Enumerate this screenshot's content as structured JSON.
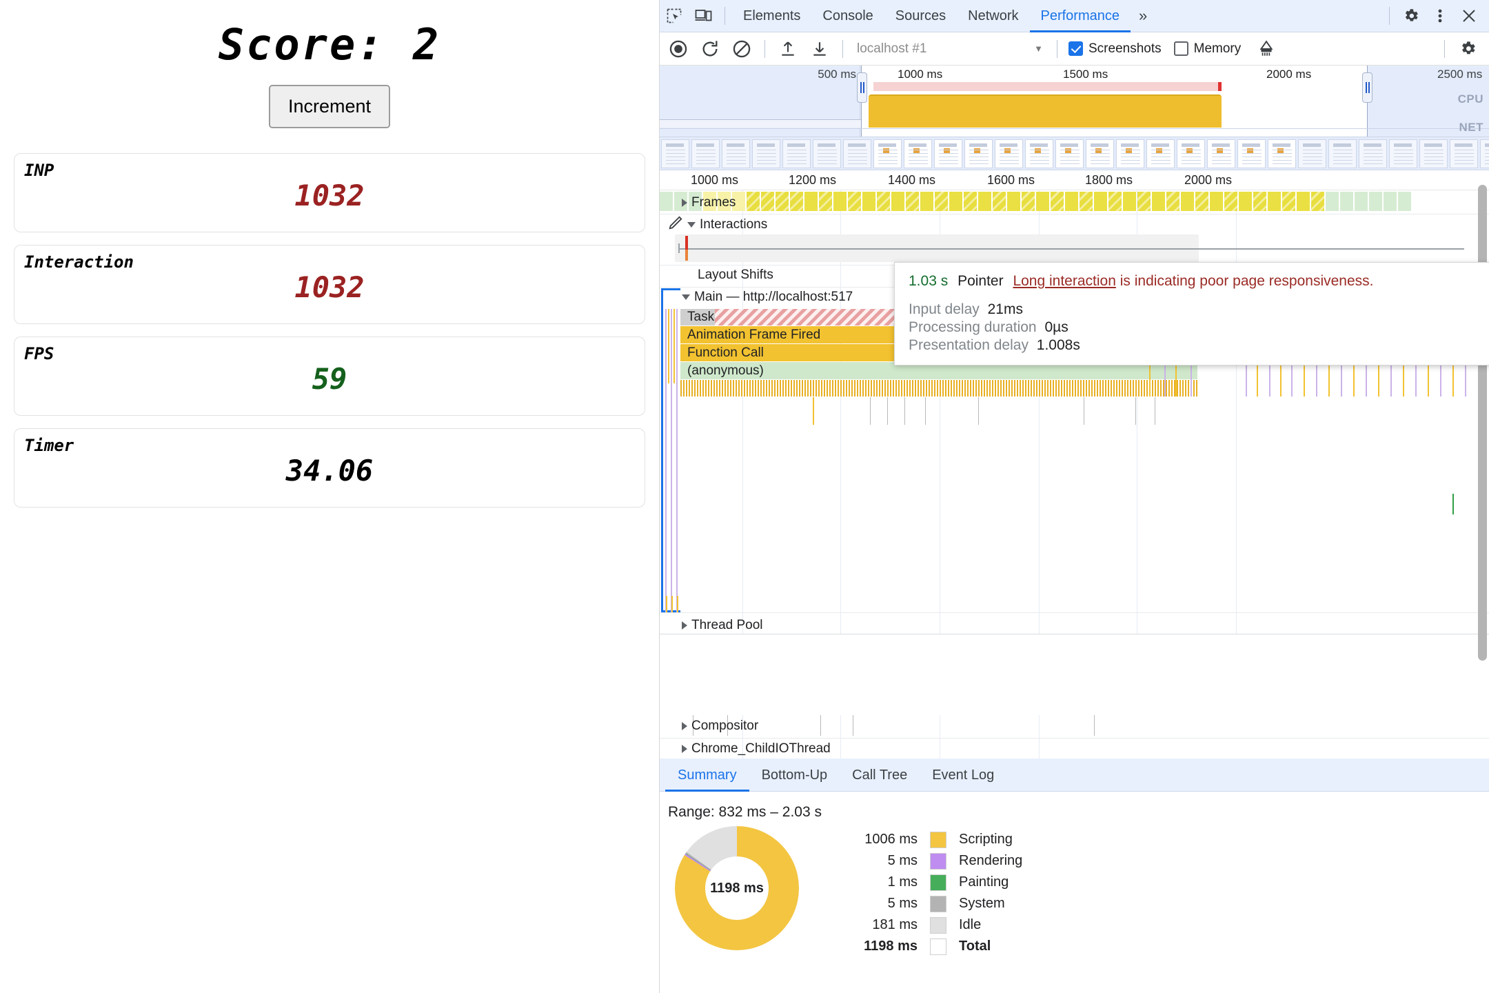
{
  "page": {
    "score_label": "Score: 2",
    "increment_button": "Increment",
    "cards": [
      {
        "label": "INP",
        "value": "1032",
        "color": "red"
      },
      {
        "label": "Interaction",
        "value": "1032",
        "color": "red"
      },
      {
        "label": "FPS",
        "value": "59",
        "color": "green"
      },
      {
        "label": "Timer",
        "value": "34.06",
        "color": "black"
      }
    ]
  },
  "devtools": {
    "tabs": [
      {
        "label": "Elements",
        "active": false
      },
      {
        "label": "Console",
        "active": false
      },
      {
        "label": "Sources",
        "active": false
      },
      {
        "label": "Network",
        "active": false
      },
      {
        "label": "Performance",
        "active": true
      }
    ],
    "more_tabs": "»",
    "icons": {
      "inspect": "inspect-element-icon",
      "device": "device-toolbar-icon",
      "settings": "gear-icon",
      "kebab": "more-options-icon",
      "close": "close-icon",
      "record": "record-icon",
      "reload": "reload-and-record-icon",
      "clear": "clear-icon",
      "load": "load-profile-icon",
      "save": "save-profile-icon",
      "collect_garbage": "collect-garbage-icon",
      "capture_settings": "capture-settings-gear-icon"
    },
    "controls": {
      "profile_selector": "localhost #1",
      "screenshots_label": "Screenshots",
      "screenshots_checked": true,
      "memory_label": "Memory",
      "memory_checked": false
    },
    "overview": {
      "ticks": [
        "500 ms",
        "1000 ms",
        "1500 ms",
        "2000 ms",
        "2500 ms"
      ],
      "cpu_label": "CPU",
      "net_label": "NET"
    },
    "ruler_ticks": [
      "1000 ms",
      "1200 ms",
      "1400 ms",
      "1600 ms",
      "1800 ms",
      "2000 ms"
    ],
    "tracks": [
      {
        "name": "Frames",
        "expanded": false
      },
      {
        "name": "Interactions",
        "expanded": true
      },
      {
        "name": "Layout Shifts",
        "expanded": false
      },
      {
        "name": "Main — http://localhost:517",
        "expanded": true
      },
      {
        "name": "Thread Pool",
        "expanded": false
      },
      {
        "name": "Compositor",
        "expanded": false
      },
      {
        "name": "Chrome_ChildIOThread",
        "expanded": false
      }
    ],
    "flame_bars": [
      {
        "label": "Task",
        "kind": "task"
      },
      {
        "label": "Animation Frame Fired",
        "kind": "js"
      },
      {
        "label": "Function Call",
        "kind": "js"
      },
      {
        "label": "(anonymous)",
        "kind": "anon"
      }
    ],
    "tooltip": {
      "time": "1.03 s",
      "type": "Pointer",
      "link": "Long interaction",
      "message": "is indicating poor page responsiveness.",
      "rows": [
        {
          "key": "Input delay",
          "value": "21ms"
        },
        {
          "key": "Processing duration",
          "value": "0µs"
        },
        {
          "key": "Presentation delay",
          "value": "1.008s"
        }
      ]
    },
    "bottom_tabs": [
      {
        "label": "Summary",
        "active": true
      },
      {
        "label": "Bottom-Up",
        "active": false
      },
      {
        "label": "Call Tree",
        "active": false
      },
      {
        "label": "Event Log",
        "active": false
      }
    ],
    "summary": {
      "range": "Range: 832 ms – 2.03 s",
      "donut_center": "1198 ms"
    }
  },
  "chart_data": {
    "type": "pie",
    "title": "Range: 832 ms – 2.03 s",
    "center_label": "1198 ms",
    "categories": [
      "Scripting",
      "Rendering",
      "Painting",
      "System",
      "Idle"
    ],
    "values": [
      1006,
      5,
      1,
      5,
      181
    ],
    "value_labels": [
      "1006 ms",
      "5 ms",
      "1 ms",
      "5 ms",
      "181 ms"
    ],
    "colors": [
      "#f3c541",
      "#bf8cf0",
      "#46ad5a",
      "#b3b3b3",
      "#e0e0e0"
    ],
    "total": 1198,
    "total_label": "1198 ms",
    "total_name": "Total",
    "unit": "ms",
    "legend_position": "right"
  }
}
